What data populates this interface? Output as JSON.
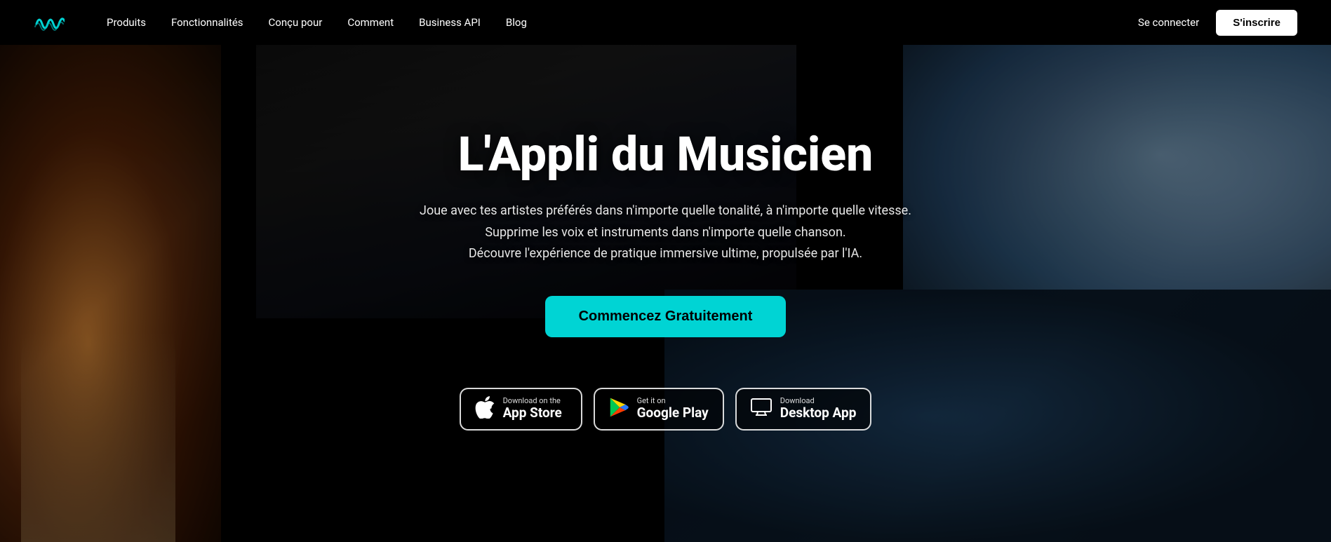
{
  "nav": {
    "links": [
      {
        "label": "Produits",
        "id": "nav-produits"
      },
      {
        "label": "Fonctionnalités",
        "id": "nav-fonctionnalites"
      },
      {
        "label": "Conçu pour",
        "id": "nav-concu-pour"
      },
      {
        "label": "Comment",
        "id": "nav-comment"
      },
      {
        "label": "Business API",
        "id": "nav-business-api"
      },
      {
        "label": "Blog",
        "id": "nav-blog"
      }
    ],
    "signin_label": "Se connecter",
    "register_label": "S'inscrire"
  },
  "hero": {
    "title": "L'Appli du Musicien",
    "subtitle_line1": "Joue avec tes artistes préférés dans n'importe quelle tonalité, à n'importe quelle vitesse.",
    "subtitle_line2": "Supprime les voix et instruments dans n'importe quelle chanson.",
    "subtitle_line3": "Découvre l'expérience de pratique immersive ultime, propulsée par l'IA.",
    "cta_label": "Commencez Gratuitement",
    "store_buttons": {
      "appstore": {
        "small": "Download on the",
        "large": "App Store"
      },
      "googleplay": {
        "small": "Get it on",
        "large": "Google Play"
      },
      "desktop": {
        "small": "Download",
        "large": "Desktop App"
      }
    }
  }
}
